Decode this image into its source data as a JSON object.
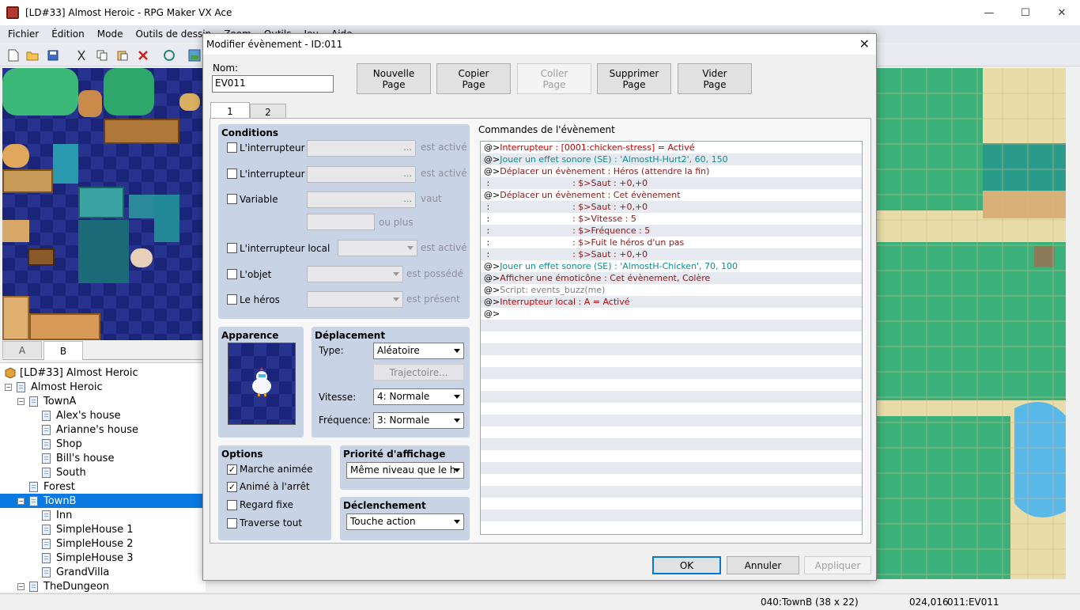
{
  "window": {
    "title": "[LD#33]  Almost Heroic - RPG Maker VX Ace",
    "minimize": "—",
    "maximize": "☐",
    "close": "✕"
  },
  "menu": [
    "Fichier",
    "Édition",
    "Mode",
    "Outils de dessin",
    "Zoom",
    "Outils",
    "Jeu",
    "Aide"
  ],
  "tile_tabs": [
    "A",
    "B"
  ],
  "tree": {
    "root": "[LD#33]  Almost Heroic",
    "items": [
      {
        "label": "Almost Heroic",
        "level": 1,
        "expander": "−"
      },
      {
        "label": "TownA",
        "level": 2,
        "expander": "−"
      },
      {
        "label": "Alex's house",
        "level": 3
      },
      {
        "label": "Arianne's house",
        "level": 3
      },
      {
        "label": "Shop",
        "level": 3
      },
      {
        "label": "Bill's house",
        "level": 3
      },
      {
        "label": "South",
        "level": 3
      },
      {
        "label": "Forest",
        "level": 2
      },
      {
        "label": "TownB",
        "level": 2,
        "expander": "−",
        "selected": true
      },
      {
        "label": "Inn",
        "level": 3
      },
      {
        "label": "SimpleHouse 1",
        "level": 3
      },
      {
        "label": "SimpleHouse 2",
        "level": 3
      },
      {
        "label": "SimpleHouse 3",
        "level": 3
      },
      {
        "label": "GrandVilla",
        "level": 3
      },
      {
        "label": "TheDungeon",
        "level": 2,
        "expander": "−"
      }
    ]
  },
  "status": {
    "map": "040:TownB (38 x 22)",
    "coords": "024,016",
    "event": "011:EV011"
  },
  "dialog": {
    "title": "Modifier évènement - ID:011",
    "close": "✕",
    "name_label": "Nom:",
    "name_value": "EV011",
    "page_buttons": [
      {
        "line1": "Nouvelle",
        "line2": "Page",
        "disabled": false
      },
      {
        "line1": "Copier",
        "line2": "Page",
        "disabled": false
      },
      {
        "line1": "Coller",
        "line2": "Page",
        "disabled": true
      },
      {
        "line1": "Supprimer",
        "line2": "Page",
        "disabled": false
      },
      {
        "line1": "Vider",
        "line2": "Page",
        "disabled": false
      }
    ],
    "tabs": [
      "1",
      "2"
    ],
    "conditions": {
      "title": "Conditions",
      "switch1": "L'interrupteur",
      "switch1_suffix": "est activé",
      "switch2": "L'interrupteur",
      "switch2_suffix": "est activé",
      "variable": "Variable",
      "variable_suffix": "vaut",
      "variable_more": "ou plus",
      "self_switch": "L'interrupteur local",
      "self_switch_suffix": "est activé",
      "item": "L'objet",
      "item_suffix": "est possédé",
      "actor": "Le héros",
      "actor_suffix": "est présent",
      "ellipsis": "..."
    },
    "appearance": {
      "title": "Apparence"
    },
    "movement": {
      "title": "Déplacement",
      "type_label": "Type:",
      "type_value": "Aléatoire",
      "route_button": "Trajectoire...",
      "speed_label": "Vitesse:",
      "speed_value": "4: Normale",
      "freq_label": "Fréquence:",
      "freq_value": "3: Normale"
    },
    "options": {
      "title": "Options",
      "items": [
        {
          "label": "Marche animée",
          "checked": true
        },
        {
          "label": "Animé à l'arrêt",
          "checked": true
        },
        {
          "label": "Regard fixe",
          "checked": false
        },
        {
          "label": "Traverse tout",
          "checked": false
        }
      ]
    },
    "priority": {
      "title": "Priorité d'affichage",
      "value": "Même niveau que le h"
    },
    "trigger": {
      "title": "Déclenchement",
      "value": "Touche action"
    },
    "commands_title": "Commandes de l'évènement",
    "commands": [
      {
        "prefix": "@>",
        "text": "Interrupteur : [0001:chicken-stress] = Activé",
        "color": "red"
      },
      {
        "prefix": "@>",
        "text": "Jouer un effet sonore (SE) : 'AlmostH-Hurt2', 60, 150",
        "color": "teal"
      },
      {
        "prefix": "@>",
        "text": "Déplacer un évènement : Héros (attendre la fin)",
        "color": "violet"
      },
      {
        "prefix": " :",
        "text": "                              : $>Saut : +0,+0",
        "color": "violet"
      },
      {
        "prefix": "@>",
        "text": "Déplacer un évènement : Cet évènement",
        "color": "violet"
      },
      {
        "prefix": " :",
        "text": "                              : $>Saut : +0,+0",
        "color": "violet"
      },
      {
        "prefix": " :",
        "text": "                              : $>Vitesse : 5",
        "color": "violet"
      },
      {
        "prefix": " :",
        "text": "                              : $>Fréquence : 5",
        "color": "violet"
      },
      {
        "prefix": " :",
        "text": "                              : $>Fuit le héros d'un pas",
        "color": "violet"
      },
      {
        "prefix": " :",
        "text": "                              : $>Saut : +0,+0",
        "color": "violet"
      },
      {
        "prefix": "@>",
        "text": "Jouer un effet sonore (SE) : 'AlmostH-Chicken', 70, 100",
        "color": "teal"
      },
      {
        "prefix": "@>",
        "text": "Afficher une émoticône : Cet évènement, Colère",
        "color": "violet"
      },
      {
        "prefix": "@>",
        "text": "Script: events_buzz(me)",
        "color": "gray"
      },
      {
        "prefix": "@>",
        "text": "Interrupteur local : A = Activé",
        "color": "red"
      },
      {
        "prefix": "@>",
        "text": "",
        "color": "blk"
      }
    ],
    "ok": "OK",
    "cancel": "Annuler",
    "apply": "Appliquer"
  }
}
